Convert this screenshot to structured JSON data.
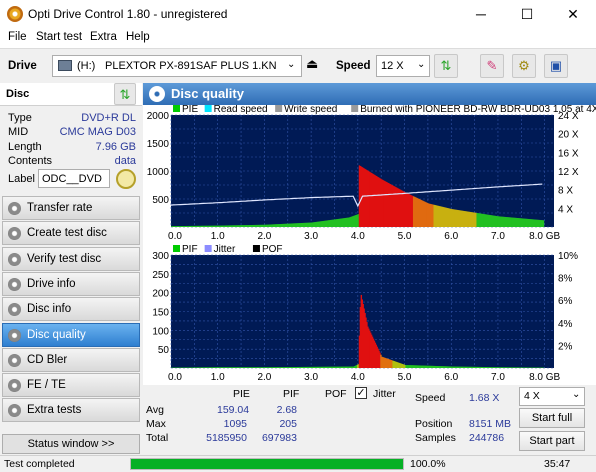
{
  "window": {
    "title": "Opti Drive Control 1.80 - unregistered",
    "minimize": "─",
    "maximize": "☐",
    "close": "✕"
  },
  "menu": [
    "File",
    "Start test",
    "Extra",
    "Help"
  ],
  "toolbar": {
    "drive_label": "Drive",
    "drive_letter": "(H:)",
    "drive_name": "PLEXTOR PX-891SAF PLUS 1.KN",
    "speed_label": "Speed",
    "speed_value": "12 X"
  },
  "disc": {
    "header": "Disc",
    "rows": [
      {
        "key": "Type",
        "value": "DVD+R DL"
      },
      {
        "key": "MID",
        "value": "CMC MAG D03"
      },
      {
        "key": "Length",
        "value": "7.96 GB"
      },
      {
        "key": "Contents",
        "value": "data"
      }
    ],
    "label_key": "Label",
    "label_value": "ODC__DVD"
  },
  "nav": [
    {
      "label": "Transfer rate",
      "selected": false
    },
    {
      "label": "Create test disc",
      "selected": false
    },
    {
      "label": "Verify test disc",
      "selected": false
    },
    {
      "label": "Drive info",
      "selected": false
    },
    {
      "label": "Disc info",
      "selected": false
    },
    {
      "label": "Disc quality",
      "selected": true
    },
    {
      "label": "CD Bler",
      "selected": false
    },
    {
      "label": "FE / TE",
      "selected": false
    },
    {
      "label": "Extra tests",
      "selected": false
    }
  ],
  "status_window_btn": "Status window >>",
  "panel_title": "Disc quality",
  "chart_data": [
    {
      "type": "area",
      "legend": [
        "PIE",
        "Read speed",
        "Write speed",
        "Burned with PIONEER BD-RW   BDR-UD03 1.05 at 4X"
      ],
      "legend_colors": [
        "#00cc00",
        "#00e5ff",
        "#9a9a9a",
        "#9a9a9a"
      ],
      "x_ticks": [
        "0.0",
        "1.0",
        "2.0",
        "3.0",
        "4.0",
        "5.0",
        "6.0",
        "7.0",
        "8.0 GB"
      ],
      "y_left_ticks": [
        "2000",
        "1500",
        "1000",
        "500"
      ],
      "y_right_ticks": [
        "24 X",
        "20 X",
        "16 X",
        "12 X",
        "8 X",
        "4 X"
      ],
      "xlim": [
        0,
        8.2
      ],
      "ylim": [
        0,
        2000
      ],
      "series": [
        {
          "name": "PIE",
          "x": [
            0.0,
            1.0,
            2.0,
            3.0,
            3.8,
            4.0,
            4.02,
            4.5,
            5.0,
            5.5,
            6.0,
            7.0,
            7.96
          ],
          "y": [
            15,
            25,
            40,
            80,
            170,
            230,
            1100,
            850,
            620,
            420,
            320,
            190,
            120
          ]
        },
        {
          "name": "Read speed",
          "x": [
            0.0,
            1.0,
            2.0,
            3.0,
            3.9,
            4.0,
            4.1,
            5.0,
            6.0,
            7.0,
            7.96
          ],
          "y": [
            4.7,
            5.2,
            5.8,
            6.3,
            6.6,
            4.5,
            6.6,
            7.2,
            7.9,
            8.6,
            9.2
          ]
        }
      ]
    },
    {
      "type": "area",
      "legend": [
        "PIF",
        "Jitter",
        "POF"
      ],
      "legend_colors": [
        "#00cc00",
        "#8c8cff",
        "#000000"
      ],
      "x_ticks": [
        "0.0",
        "1.0",
        "2.0",
        "3.0",
        "4.0",
        "5.0",
        "6.0",
        "7.0",
        "8.0 GB"
      ],
      "y_left_ticks": [
        "300",
        "250",
        "200",
        "150",
        "100",
        "50"
      ],
      "y_right_ticks": [
        "10%",
        "8%",
        "6%",
        "4%",
        "2%"
      ],
      "xlim": [
        0,
        8.2
      ],
      "ylim": [
        0,
        300
      ],
      "series": [
        {
          "name": "PIF",
          "x": [
            0.0,
            1.0,
            2.0,
            3.0,
            3.9,
            4.0,
            4.05,
            4.2,
            4.5,
            5.0,
            6.0,
            7.0,
            7.96
          ],
          "y": [
            1,
            2,
            2,
            3,
            4,
            10,
            200,
            110,
            30,
            8,
            4,
            2,
            1
          ]
        }
      ]
    }
  ],
  "stats": {
    "cols": [
      "PIE",
      "PIF",
      "POF"
    ],
    "jitter_label": "Jitter",
    "jitter_checked": true,
    "rows": [
      {
        "label": "Avg",
        "pie": "159.04",
        "pif": "2.68",
        "pof": ""
      },
      {
        "label": "Max",
        "pie": "1095",
        "pif": "205",
        "pof": ""
      },
      {
        "label": "Total",
        "pie": "5185950",
        "pif": "697983",
        "pof": ""
      }
    ],
    "speed_label": "Speed",
    "speed_value": "1.68 X",
    "position_label": "Position",
    "position_value": "8151 MB",
    "samples_label": "Samples",
    "samples_value": "244786",
    "test_speed": "4 X",
    "start_full": "Start full",
    "start_part": "Start part"
  },
  "status": {
    "text": "Test completed",
    "progress": 1.0,
    "progress_text": "100.0%",
    "time": "35:47"
  }
}
